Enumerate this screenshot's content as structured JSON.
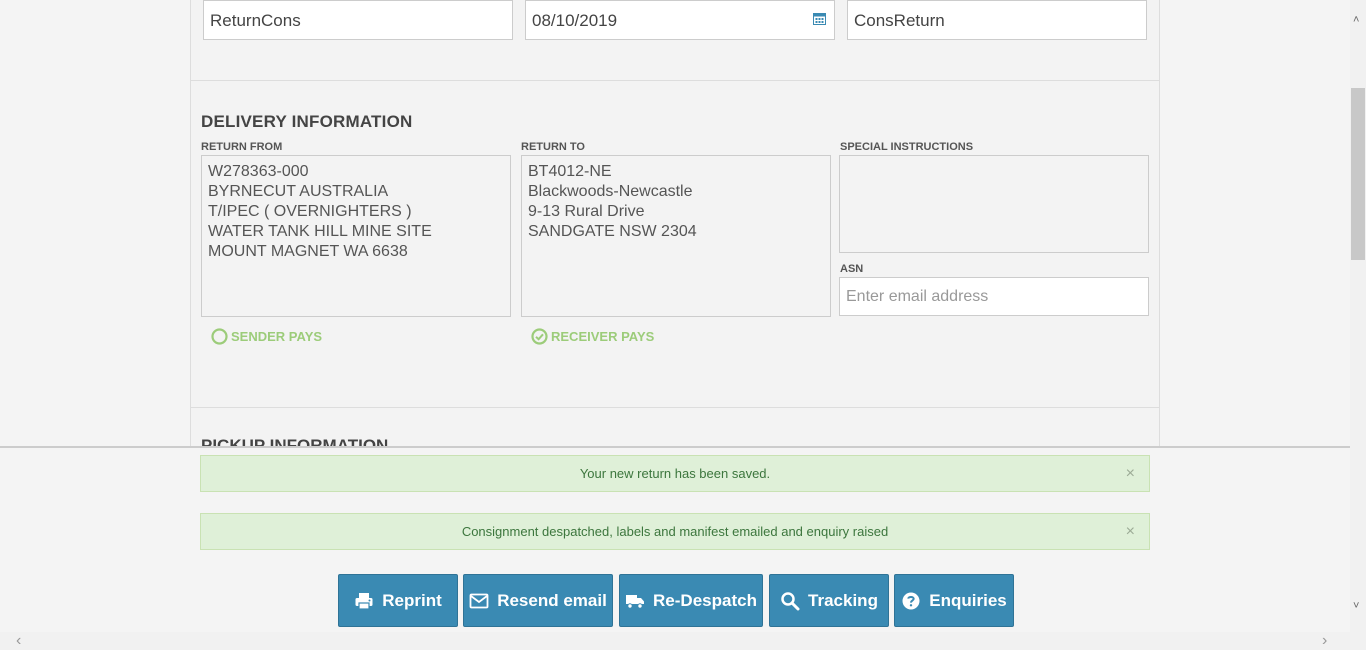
{
  "top_fields": {
    "reference": "ReturnCons",
    "date": "08/10/2019",
    "type": "ConsReturn"
  },
  "delivery": {
    "title": "DELIVERY INFORMATION",
    "return_from_label": "RETURN FROM",
    "return_from_lines": [
      "W278363-000",
      "BYRNECUT AUSTRALIA",
      "T/IPEC ( OVERNIGHTERS )",
      "WATER TANK HILL MINE SITE",
      "MOUNT MAGNET WA 6638"
    ],
    "return_to_label": "RETURN TO",
    "return_to_lines": [
      "BT4012-NE",
      "Blackwoods-Newcastle",
      "9-13 Rural Drive",
      "SANDGATE NSW 2304"
    ],
    "special_instructions_label": "SPECIAL INSTRUCTIONS",
    "asn_label": "ASN",
    "asn_placeholder": "Enter email address",
    "sender_pays": "SENDER PAYS",
    "receiver_pays": "RECEIVER PAYS"
  },
  "pickup": {
    "title": "PICKUP INFORMATION"
  },
  "alerts": [
    {
      "text": "Your new return has been saved.",
      "close": "×"
    },
    {
      "text": "Consignment despatched, labels and manifest emailed and enquiry raised",
      "close": "×"
    }
  ],
  "buttons": {
    "reprint": "Reprint",
    "resend_email": "Resend email",
    "re_despatch": "Re-Despatch",
    "tracking": "Tracking",
    "enquiries": "Enquiries"
  },
  "colors": {
    "button_bg": "#3a8ab3",
    "alert_bg": "#dff0d8",
    "pay_green": "#9ccc7a"
  }
}
